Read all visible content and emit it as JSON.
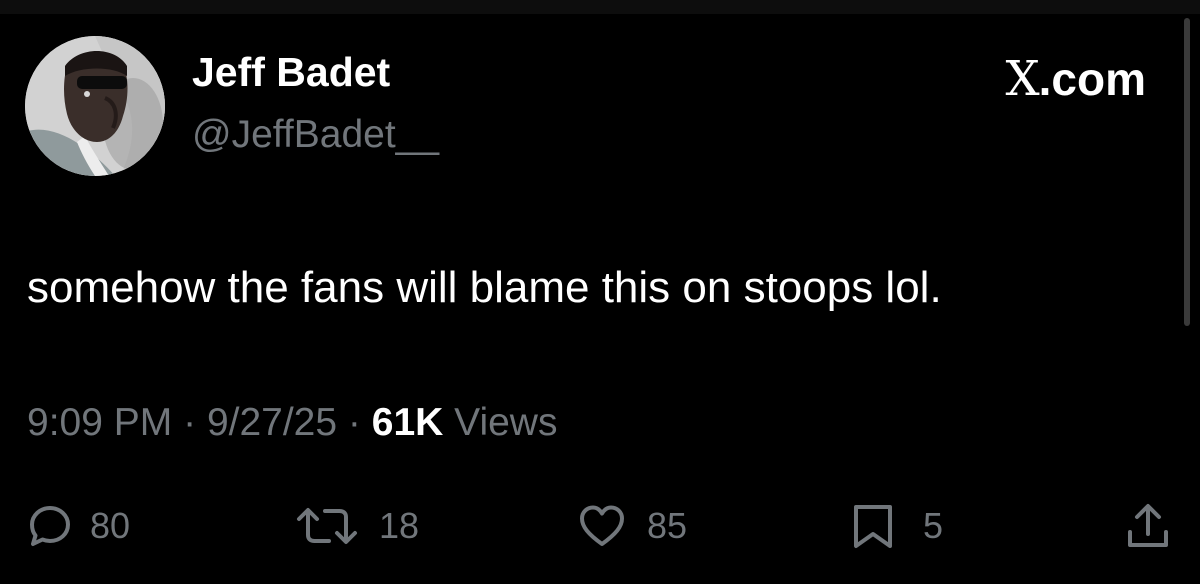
{
  "tweet": {
    "display_name": "Jeff Badet",
    "handle": "@JeffBadet__",
    "site": {
      "logo_letter": "X",
      "suffix": ".com"
    },
    "text": "somehow the fans will blame this on stoops lol.",
    "time": "9:09 PM",
    "separator": "·",
    "date": "9/27/25",
    "views_count": "61K",
    "views_label": "Views"
  },
  "actions": {
    "replies": "80",
    "reposts": "18",
    "likes": "85",
    "bookmarks": "5"
  },
  "icons": {
    "reply": "reply-icon",
    "repost": "repost-icon",
    "like": "heart-icon",
    "bookmark": "bookmark-icon",
    "share": "share-icon"
  },
  "colors": {
    "background": "#000000",
    "primary_text": "#ffffff",
    "secondary_text": "#71767b"
  }
}
